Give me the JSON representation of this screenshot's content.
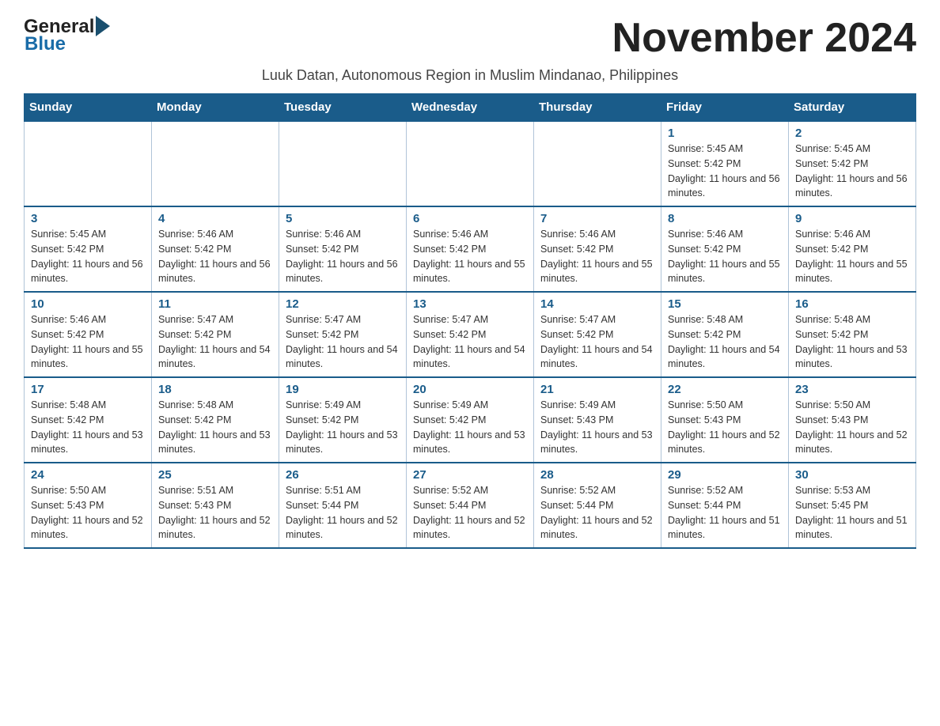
{
  "logo": {
    "general": "General",
    "blue": "Blue"
  },
  "title": "November 2024",
  "subtitle": "Luuk Datan, Autonomous Region in Muslim Mindanao, Philippines",
  "days_of_week": [
    "Sunday",
    "Monday",
    "Tuesday",
    "Wednesday",
    "Thursday",
    "Friday",
    "Saturday"
  ],
  "weeks": [
    [
      {
        "day": "",
        "info": ""
      },
      {
        "day": "",
        "info": ""
      },
      {
        "day": "",
        "info": ""
      },
      {
        "day": "",
        "info": ""
      },
      {
        "day": "",
        "info": ""
      },
      {
        "day": "1",
        "info": "Sunrise: 5:45 AM\nSunset: 5:42 PM\nDaylight: 11 hours and 56 minutes."
      },
      {
        "day": "2",
        "info": "Sunrise: 5:45 AM\nSunset: 5:42 PM\nDaylight: 11 hours and 56 minutes."
      }
    ],
    [
      {
        "day": "3",
        "info": "Sunrise: 5:45 AM\nSunset: 5:42 PM\nDaylight: 11 hours and 56 minutes."
      },
      {
        "day": "4",
        "info": "Sunrise: 5:46 AM\nSunset: 5:42 PM\nDaylight: 11 hours and 56 minutes."
      },
      {
        "day": "5",
        "info": "Sunrise: 5:46 AM\nSunset: 5:42 PM\nDaylight: 11 hours and 56 minutes."
      },
      {
        "day": "6",
        "info": "Sunrise: 5:46 AM\nSunset: 5:42 PM\nDaylight: 11 hours and 55 minutes."
      },
      {
        "day": "7",
        "info": "Sunrise: 5:46 AM\nSunset: 5:42 PM\nDaylight: 11 hours and 55 minutes."
      },
      {
        "day": "8",
        "info": "Sunrise: 5:46 AM\nSunset: 5:42 PM\nDaylight: 11 hours and 55 minutes."
      },
      {
        "day": "9",
        "info": "Sunrise: 5:46 AM\nSunset: 5:42 PM\nDaylight: 11 hours and 55 minutes."
      }
    ],
    [
      {
        "day": "10",
        "info": "Sunrise: 5:46 AM\nSunset: 5:42 PM\nDaylight: 11 hours and 55 minutes."
      },
      {
        "day": "11",
        "info": "Sunrise: 5:47 AM\nSunset: 5:42 PM\nDaylight: 11 hours and 54 minutes."
      },
      {
        "day": "12",
        "info": "Sunrise: 5:47 AM\nSunset: 5:42 PM\nDaylight: 11 hours and 54 minutes."
      },
      {
        "day": "13",
        "info": "Sunrise: 5:47 AM\nSunset: 5:42 PM\nDaylight: 11 hours and 54 minutes."
      },
      {
        "day": "14",
        "info": "Sunrise: 5:47 AM\nSunset: 5:42 PM\nDaylight: 11 hours and 54 minutes."
      },
      {
        "day": "15",
        "info": "Sunrise: 5:48 AM\nSunset: 5:42 PM\nDaylight: 11 hours and 54 minutes."
      },
      {
        "day": "16",
        "info": "Sunrise: 5:48 AM\nSunset: 5:42 PM\nDaylight: 11 hours and 53 minutes."
      }
    ],
    [
      {
        "day": "17",
        "info": "Sunrise: 5:48 AM\nSunset: 5:42 PM\nDaylight: 11 hours and 53 minutes."
      },
      {
        "day": "18",
        "info": "Sunrise: 5:48 AM\nSunset: 5:42 PM\nDaylight: 11 hours and 53 minutes."
      },
      {
        "day": "19",
        "info": "Sunrise: 5:49 AM\nSunset: 5:42 PM\nDaylight: 11 hours and 53 minutes."
      },
      {
        "day": "20",
        "info": "Sunrise: 5:49 AM\nSunset: 5:42 PM\nDaylight: 11 hours and 53 minutes."
      },
      {
        "day": "21",
        "info": "Sunrise: 5:49 AM\nSunset: 5:43 PM\nDaylight: 11 hours and 53 minutes."
      },
      {
        "day": "22",
        "info": "Sunrise: 5:50 AM\nSunset: 5:43 PM\nDaylight: 11 hours and 52 minutes."
      },
      {
        "day": "23",
        "info": "Sunrise: 5:50 AM\nSunset: 5:43 PM\nDaylight: 11 hours and 52 minutes."
      }
    ],
    [
      {
        "day": "24",
        "info": "Sunrise: 5:50 AM\nSunset: 5:43 PM\nDaylight: 11 hours and 52 minutes."
      },
      {
        "day": "25",
        "info": "Sunrise: 5:51 AM\nSunset: 5:43 PM\nDaylight: 11 hours and 52 minutes."
      },
      {
        "day": "26",
        "info": "Sunrise: 5:51 AM\nSunset: 5:44 PM\nDaylight: 11 hours and 52 minutes."
      },
      {
        "day": "27",
        "info": "Sunrise: 5:52 AM\nSunset: 5:44 PM\nDaylight: 11 hours and 52 minutes."
      },
      {
        "day": "28",
        "info": "Sunrise: 5:52 AM\nSunset: 5:44 PM\nDaylight: 11 hours and 52 minutes."
      },
      {
        "day": "29",
        "info": "Sunrise: 5:52 AM\nSunset: 5:44 PM\nDaylight: 11 hours and 51 minutes."
      },
      {
        "day": "30",
        "info": "Sunrise: 5:53 AM\nSunset: 5:45 PM\nDaylight: 11 hours and 51 minutes."
      }
    ]
  ]
}
